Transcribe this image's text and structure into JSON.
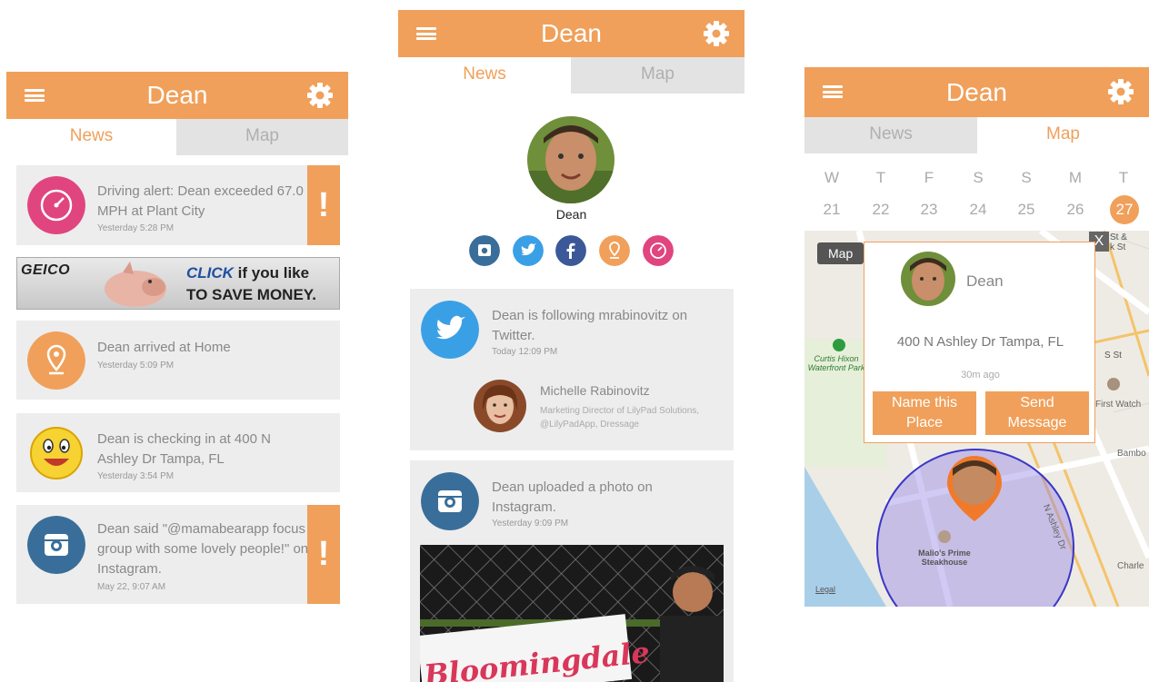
{
  "app": {
    "profile_name": "Dean"
  },
  "tabs": {
    "news": "News",
    "map": "Map"
  },
  "left_feed": {
    "items": [
      {
        "text": "Driving alert: Dean exceeded 67.0 MPH at Plant City",
        "time": "Yesterday 5:28 PM"
      },
      {
        "text": "Dean arrived at Home",
        "time": "Yesterday 5:09 PM"
      },
      {
        "text": "Dean is checking in at 400 N Ashley Dr Tampa, FL",
        "time": "Yesterday 3:54 PM"
      },
      {
        "text": "Dean said \"@mamabearapp focus group with some lovely people!\" on Instagram.",
        "time": "May 22, 9:07 AM"
      }
    ],
    "alert_mark": "!",
    "ad": {
      "brand": "GEICO",
      "click": "CLICK",
      "line1_rest": " if you like",
      "line2": "TO SAVE MONEY."
    }
  },
  "mid_feed": {
    "profile_name": "Dean",
    "twitter_post": {
      "text": "Dean is following mrabinovitz on Twitter.",
      "time": "Today 12:09 PM"
    },
    "followed_person": {
      "name": "Michelle Rabinovitz",
      "bio": "Marketing Director of LilyPad Solutions, @LilyPadApp, Dressage"
    },
    "instagram_post": {
      "text": "Dean uploaded a photo on Instagram.",
      "time": "Yesterday 9:09 PM"
    },
    "photo_banner_text": "Bloomingdale"
  },
  "map_view": {
    "week_days": [
      "W",
      "T",
      "F",
      "S",
      "S",
      "M",
      "T"
    ],
    "week_dates": [
      "21",
      "22",
      "23",
      "24",
      "25",
      "26",
      "27"
    ],
    "map_type_button": "Map",
    "close_label": "X",
    "popup": {
      "name": "Dean",
      "address": "400 N Ashley Dr Tampa, FL",
      "ago": "30m ago",
      "name_place_button": "Name this Place",
      "send_message_button": "Send Message"
    },
    "labels": {
      "park": "Curtis Hixon Waterfront Park",
      "restaurant": "Malio's Prime Steakhouse",
      "first_watch": "First Watch",
      "bamboo": "Bambo",
      "charley": "Charle",
      "street_ashley": "N Ashley Dr",
      "street_s": "S St",
      "street_st": "St &\nk St",
      "legal": "Legal"
    }
  },
  "colors": {
    "accent": "#f0a05a",
    "twitter": "#3aa0e6",
    "instagram": "#3a6e9a",
    "facebook": "#3b5998",
    "pink": "#e0457f"
  }
}
